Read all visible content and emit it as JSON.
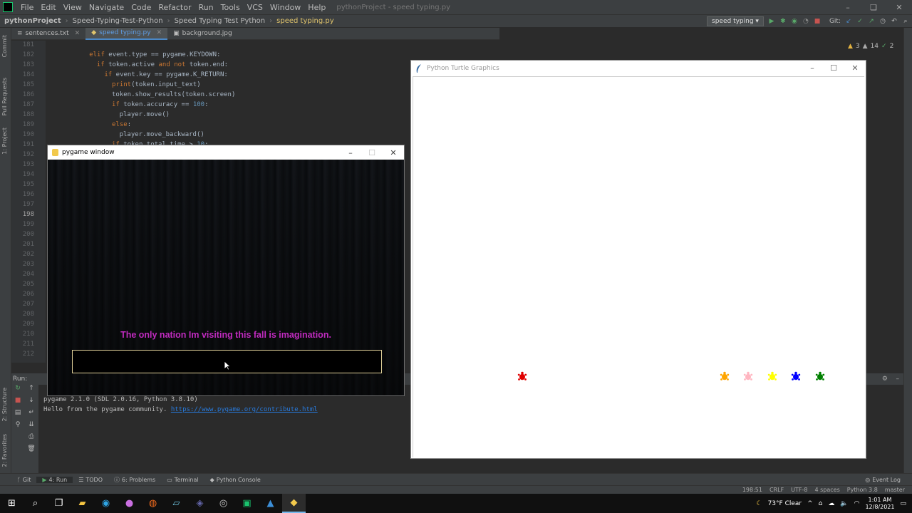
{
  "ide": {
    "menu": [
      "File",
      "Edit",
      "View",
      "Navigate",
      "Code",
      "Refactor",
      "Run",
      "Tools",
      "VCS",
      "Window",
      "Help"
    ],
    "window_title": "pythonProject - speed typing.py",
    "breadcrumbs": [
      "pythonProject",
      "Speed-Typing-Test-Python",
      "Speed Typing Test Python",
      "speed typing.py"
    ],
    "run_config": "speed typing",
    "git_label": "Git:",
    "tabs": [
      {
        "label": "sentences.txt",
        "active": false
      },
      {
        "label": "speed typing.py",
        "active": true
      },
      {
        "label": "background.jpg",
        "active": false
      }
    ],
    "inspections": {
      "warnings": "3",
      "weak": "14",
      "typos": "2"
    },
    "line_numbers": [
      "181",
      "182",
      "183",
      "184",
      "185",
      "186",
      "187",
      "188",
      "189",
      "190",
      "191",
      "192",
      "193",
      "194",
      "195",
      "196",
      "197",
      "198",
      "199",
      "200",
      "201",
      "202",
      "203",
      "204",
      "205",
      "206",
      "207",
      "208",
      "209",
      "210",
      "211",
      "212"
    ],
    "code_lines": [
      {
        "indent": 4,
        "tokens": [
          {
            "t": "elif ",
            "k": "kw"
          },
          {
            "t": "event.type == pygame.KEYDOWN:",
            "k": "plain"
          }
        ]
      },
      {
        "indent": 6,
        "tokens": [
          {
            "t": "if ",
            "k": "kw"
          },
          {
            "t": "token.active ",
            "k": "plain"
          },
          {
            "t": "and not ",
            "k": "kw"
          },
          {
            "t": "token.end:",
            "k": "plain"
          }
        ]
      },
      {
        "indent": 8,
        "tokens": [
          {
            "t": "if ",
            "k": "kw"
          },
          {
            "t": "event.key == pygame.K_RETURN:",
            "k": "plain"
          }
        ]
      },
      {
        "indent": 10,
        "tokens": [
          {
            "t": "print",
            "k": "kw"
          },
          {
            "t": "(token.input_text)",
            "k": "plain"
          }
        ]
      },
      {
        "indent": 10,
        "tokens": [
          {
            "t": "token.show_results(token.screen)",
            "k": "plain"
          }
        ]
      },
      {
        "indent": 10,
        "tokens": [
          {
            "t": "if ",
            "k": "kw"
          },
          {
            "t": "token.accuracy == ",
            "k": "plain"
          },
          {
            "t": "100",
            "k": "num"
          },
          {
            "t": ":",
            "k": "plain"
          }
        ]
      },
      {
        "indent": 12,
        "tokens": [
          {
            "t": "player.move()",
            "k": "plain"
          }
        ]
      },
      {
        "indent": 10,
        "tokens": [
          {
            "t": "else",
            "k": "kw"
          },
          {
            "t": ":",
            "k": "plain"
          }
        ]
      },
      {
        "indent": 12,
        "tokens": [
          {
            "t": "player.move_backward()",
            "k": "plain"
          }
        ]
      },
      {
        "indent": 10,
        "tokens": [
          {
            "t": "if ",
            "k": "kw"
          },
          {
            "t": "token.total_time > ",
            "k": "plain"
          },
          {
            "t": "10",
            "k": "num"
          },
          {
            "t": ":",
            "k": "plain"
          }
        ]
      }
    ],
    "run_label": "Run:",
    "console": {
      "line1": "pygame 2.1.0 (SDL 2.0.16, Python 3.8.10)",
      "line2_prefix": "Hello from the pygame community. ",
      "line2_link": "https://www.pygame.org/contribute.html"
    },
    "left_strip": [
      "1: Project",
      "Pull Requests",
      "Commit"
    ],
    "left_strip_bottom": [
      "2: Structure",
      "2: Favorites"
    ],
    "tool_windows": [
      "Git",
      "4: Run",
      "TODO",
      "6: Problems",
      "Terminal",
      "Python Console"
    ],
    "event_log": "Event Log",
    "status": {
      "position": "198:51",
      "line_sep": "CRLF",
      "encoding": "UTF-8",
      "indent": "4 spaces",
      "interpreter": "Python 3.8",
      "branch": "master"
    }
  },
  "pygame_window": {
    "title": "pygame window",
    "sentence": "The only nation Im visiting this fall is imagination.",
    "sentence_color": "#c02bbf",
    "input_value": "",
    "input_border_color": "#e2d29a"
  },
  "turtle_window": {
    "title": "Python Turtle Graphics",
    "turtles": [
      {
        "color": "#e00000",
        "name": "red-turtle"
      },
      {
        "color": "#ffa500",
        "name": "orange-turtle"
      },
      {
        "color": "#ffb6c1",
        "name": "pink-turtle"
      },
      {
        "color": "#ffff00",
        "name": "yellow-turtle"
      },
      {
        "color": "#0000ff",
        "name": "blue-turtle"
      },
      {
        "color": "#008000",
        "name": "green-turtle"
      }
    ]
  },
  "taskbar": {
    "weather": "73°F  Clear",
    "time": "1:01 AM",
    "date": "12/8/2021"
  }
}
